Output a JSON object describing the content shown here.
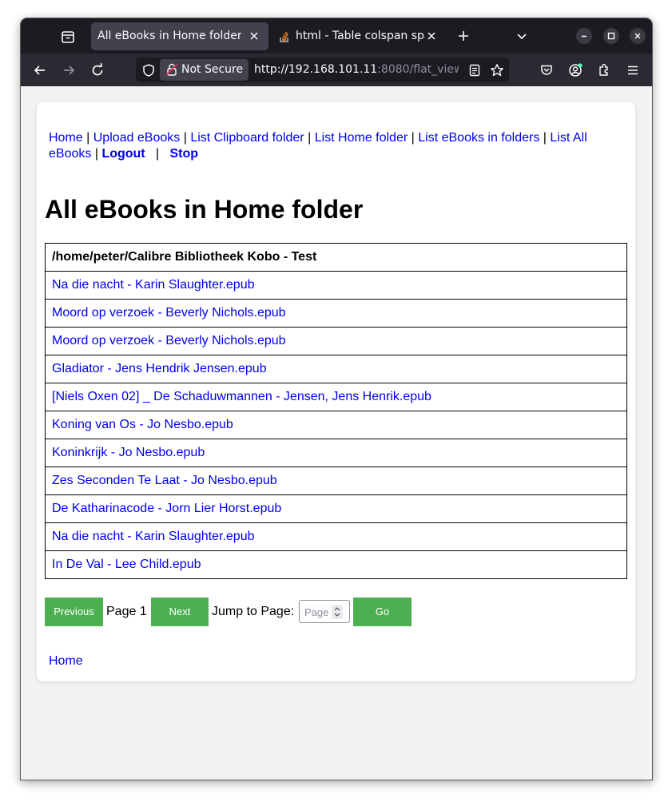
{
  "browser": {
    "tabs": [
      {
        "label": "All eBooks in Home folder",
        "active": true
      },
      {
        "label": "html - Table colspan span",
        "active": false
      }
    ],
    "security_label": "Not Secure",
    "url_host": "http://192.168.101.11",
    "url_rest": ":8080/flat_view"
  },
  "nav": {
    "home": "Home",
    "upload": "Upload eBooks",
    "clipboard": "List Clipboard folder",
    "home_folder": "List Home folder",
    "ebooks_in_folders": "List eBooks in folders",
    "list_all": "List All eBooks",
    "logout": "Logout",
    "stop": "Stop",
    "separator": "|"
  },
  "page": {
    "title": "All eBooks in Home folder"
  },
  "table": {
    "header": "/home/peter/Calibre Bibliotheek Kobo - Test",
    "rows": [
      "Na die nacht - Karin Slaughter.epub",
      "Moord op verzoek - Beverly Nichols.epub",
      "Moord op verzoek - Beverly Nichols.epub",
      "Gladiator - Jens Hendrik Jensen.epub",
      "[Niels Oxen 02] _ De Schaduwmannen - Jensen, Jens Henrik.epub",
      "Koning van Os - Jo Nesbo.epub",
      "Koninkrijk - Jo Nesbo.epub",
      "Zes Seconden Te Laat - Jo Nesbo.epub",
      "De Katharinacode - Jorn Lier Horst.epub",
      "Na die nacht - Karin Slaughter.epub",
      "In De Val - Lee Child.epub"
    ]
  },
  "pagination": {
    "previous": "Previous",
    "page_label": "Page 1",
    "next": "Next",
    "jump_label": "Jump to Page:",
    "input_placeholder": "Page",
    "go": "Go"
  },
  "footer": {
    "home": "Home"
  },
  "colors": {
    "link": "#0000ee",
    "button_green": "#4caf50",
    "browser_dark": "#1c1b22",
    "browser_toolbar": "#2b2a33"
  }
}
